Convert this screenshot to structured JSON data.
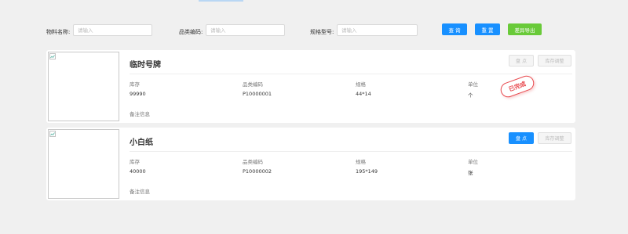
{
  "filters": {
    "material_name_label": "物料名称:",
    "material_name_placeholder": "请输入",
    "category_code_label": "品类编码:",
    "category_code_placeholder": "请输入",
    "spec_label": "规格型号:",
    "spec_placeholder": "请输入",
    "search_label": "查 询",
    "reset_label": "重 置",
    "export_label": "差异导出"
  },
  "items": [
    {
      "title": "临时号牌",
      "stock_label": "库存",
      "stock": "99990",
      "code_label": "品类编码",
      "code": "P10000001",
      "spec_label": "规格",
      "spec": "44*14",
      "unit_label": "单位",
      "unit": "个",
      "remark_label": "备注信息",
      "check_label": "盘 点",
      "adjust_label": "库存调整",
      "stamp_label": "已完成",
      "check_enabled": false
    },
    {
      "title": "小白纸",
      "stock_label": "库存",
      "stock": "40000",
      "code_label": "品类编码",
      "code": "P10000002",
      "spec_label": "规格",
      "spec": "195*149",
      "unit_label": "单位",
      "unit": "张",
      "remark_label": "备注信息",
      "check_label": "盘 点",
      "adjust_label": "库存调整",
      "check_enabled": true
    }
  ],
  "colors": {
    "primary": "#1890ff",
    "success": "#52c41a",
    "stamp": "#e8484d",
    "background": "#f0f0f0"
  }
}
